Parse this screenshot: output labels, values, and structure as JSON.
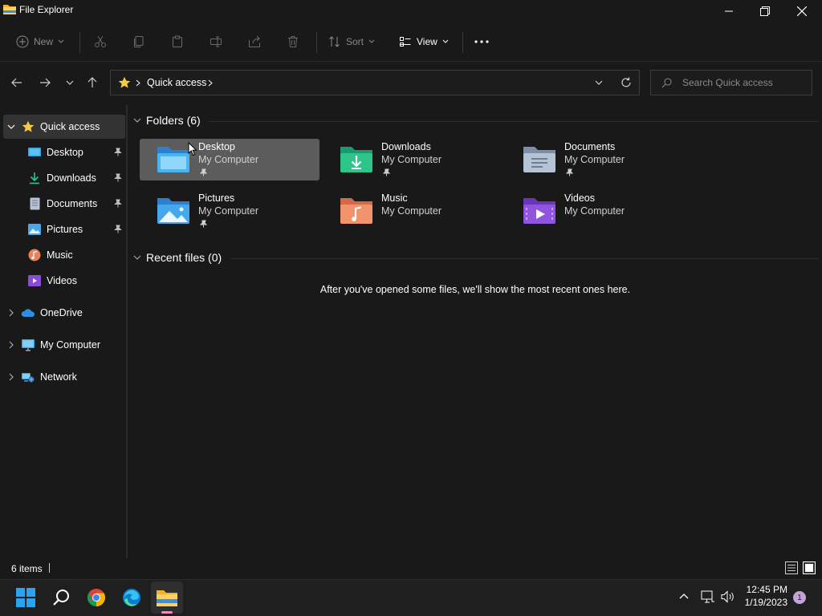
{
  "window": {
    "title": "File Explorer"
  },
  "toolbar": {
    "new_label": "New",
    "sort_label": "Sort",
    "view_label": "View",
    "more_label": "···"
  },
  "address": {
    "root_icon": "star-icon",
    "path": [
      "Quick access"
    ],
    "search_placeholder": "Search Quick access"
  },
  "sidebar": {
    "items": [
      {
        "label": "Quick access",
        "icon": "star-icon",
        "selected": true
      },
      {
        "label": "Desktop",
        "icon": "desktop-icon",
        "pinned": true
      },
      {
        "label": "Downloads",
        "icon": "download-icon",
        "pinned": true
      },
      {
        "label": "Documents",
        "icon": "document-icon",
        "pinned": true
      },
      {
        "label": "Pictures",
        "icon": "pictures-icon",
        "pinned": true
      },
      {
        "label": "Music",
        "icon": "music-icon"
      },
      {
        "label": "Videos",
        "icon": "videos-icon"
      },
      {
        "label": "OneDrive",
        "icon": "cloud-icon"
      },
      {
        "label": "My Computer",
        "icon": "monitor-icon"
      },
      {
        "label": "Network",
        "icon": "network-icon"
      }
    ]
  },
  "main": {
    "folders_header": "Folders (6)",
    "folders": [
      {
        "name": "Desktop",
        "location": "My Computer",
        "pinned": true,
        "icon": "desktop-folder-icon",
        "selected": true
      },
      {
        "name": "Downloads",
        "location": "My Computer",
        "pinned": true,
        "icon": "downloads-folder-icon"
      },
      {
        "name": "Documents",
        "location": "My Computer",
        "pinned": true,
        "icon": "documents-folder-icon"
      },
      {
        "name": "Pictures",
        "location": "My Computer",
        "pinned": true,
        "icon": "pictures-folder-icon"
      },
      {
        "name": "Music",
        "location": "My Computer",
        "pinned": false,
        "icon": "music-folder-icon"
      },
      {
        "name": "Videos",
        "location": "My Computer",
        "pinned": false,
        "icon": "videos-folder-icon"
      }
    ],
    "recent_header": "Recent files (0)",
    "recent_empty_message": "After you've opened some files, we'll show the most recent ones here."
  },
  "statusbar": {
    "item_count": "6 items"
  },
  "taskbar": {
    "apps": [
      "start-icon",
      "search-icon",
      "chrome-icon",
      "edge-icon",
      "file-explorer-icon"
    ],
    "time": "12:45 PM",
    "date": "1/19/2023",
    "notification_count": "1"
  },
  "colors": {
    "background": "#191919",
    "selected_tile": "#5c5c5c",
    "selected_nav": "#333333",
    "accent_yellow": "#f7c948",
    "notification_badge": "#c5a3d9"
  }
}
